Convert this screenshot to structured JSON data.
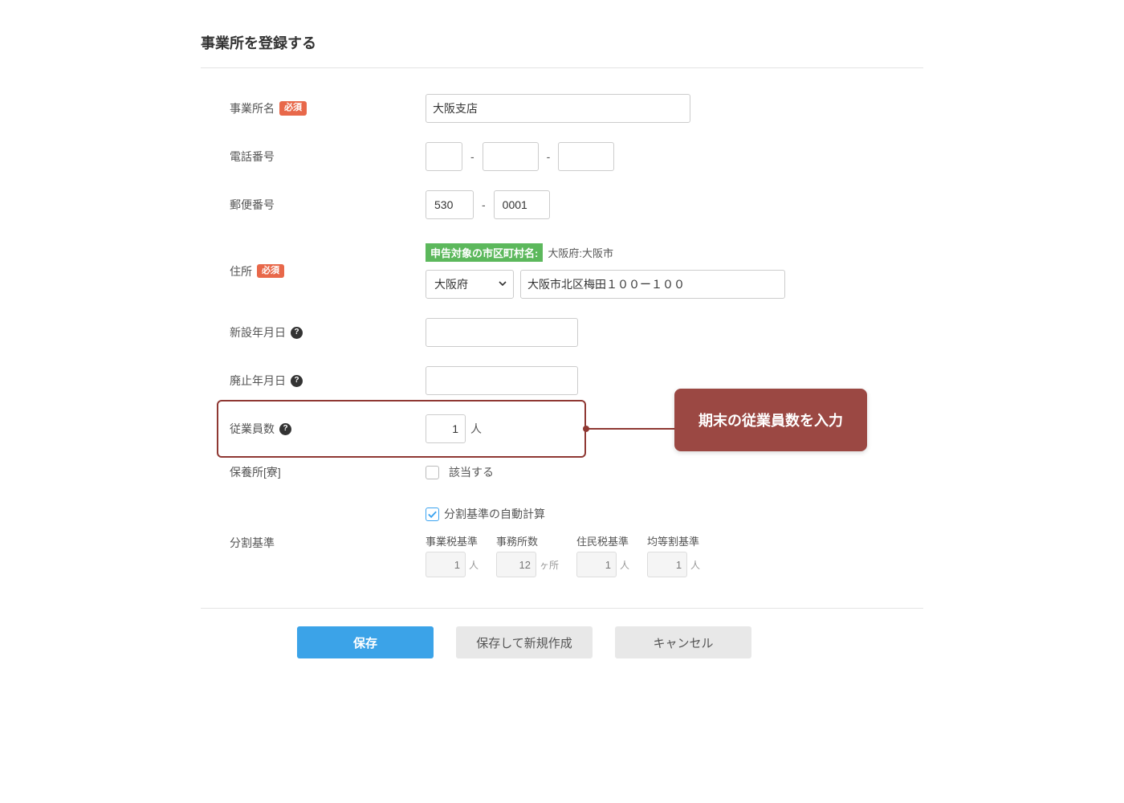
{
  "title": "事業所を登録する",
  "required_badge": "必須",
  "fields": {
    "office_name": {
      "label": "事業所名",
      "value": "大阪支店"
    },
    "phone": {
      "label": "電話番号",
      "p1": "",
      "p2": "",
      "p3": ""
    },
    "postal": {
      "label": "郵便番号",
      "z1": "530",
      "z2": "0001"
    },
    "address": {
      "label": "住所",
      "target_badge": "申告対象の市区町村名:",
      "target_city": "大阪府:大阪市",
      "pref": "大阪府",
      "detail": "大阪市北区梅田１００ー１００"
    },
    "open_date": {
      "label": "新設年月日",
      "value": ""
    },
    "close_date": {
      "label": "廃止年月日",
      "value": ""
    },
    "employees": {
      "label": "従業員数",
      "value": "1",
      "unit": "人"
    },
    "resort": {
      "label": "保養所[寮]",
      "checkbox_label": "該当する",
      "checked": false
    },
    "split": {
      "label": "分割基準",
      "auto_label": "分割基準の自動計算",
      "auto_checked": true,
      "cols": [
        {
          "lab": "事業税基準",
          "val": "1",
          "unit": "人"
        },
        {
          "lab": "事務所数",
          "val": "12",
          "unit": "ヶ所"
        },
        {
          "lab": "住民税基準",
          "val": "1",
          "unit": "人"
        },
        {
          "lab": "均等割基準",
          "val": "1",
          "unit": "人"
        }
      ]
    }
  },
  "callout_text": "期末の従業員数を入力",
  "buttons": {
    "save": "保存",
    "save_new": "保存して新規作成",
    "cancel": "キャンセル"
  }
}
